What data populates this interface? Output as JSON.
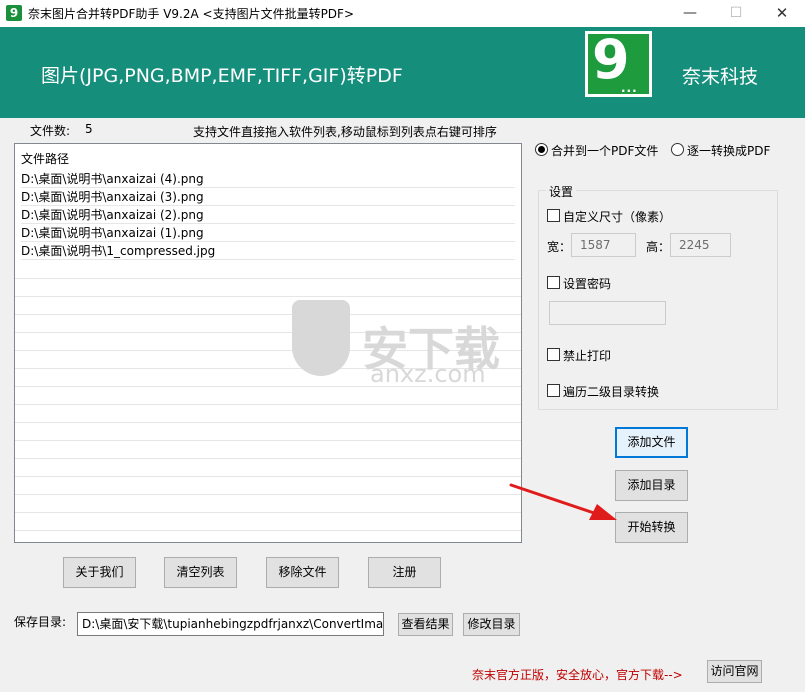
{
  "window": {
    "title": "奈末图片合并转PDF助手 V9.2A  <支持图片文件批量转PDF>",
    "icon_glyph": "9",
    "controls": {
      "minimize": "—",
      "maximize": "☐",
      "close": "✕"
    }
  },
  "banner": {
    "title": "图片(JPG,PNG,BMP,EMF,TIFF,GIF)转PDF",
    "logo_digit": "9",
    "logo_dots": "...",
    "company": "奈末科技",
    "color": "#168e7c"
  },
  "file_count": {
    "label": "文件数:",
    "value": "5"
  },
  "hint": "支持文件直接拖入软件列表,移动鼠标到列表点右键可排序",
  "file_list": {
    "header": "文件路径",
    "rows": [
      "D:\\桌面\\说明书\\anxaizai (4).png",
      "D:\\桌面\\说明书\\anxaizai (3).png",
      "D:\\桌面\\说明书\\anxaizai (2).png",
      "D:\\桌面\\说明书\\anxaizai (1).png",
      "D:\\桌面\\说明书\\1_compressed.jpg"
    ]
  },
  "watermark": {
    "text": "安下载",
    "sub": "anxz.com"
  },
  "mode": {
    "merge_label": "合并到一个PDF文件",
    "each_label": "逐一转换成PDF",
    "selected": "merge"
  },
  "settings": {
    "legend": "设置",
    "custom_size_label": "自定义尺寸（像素）",
    "width_label": "宽：",
    "width_value": "1587",
    "height_label": "高：",
    "height_value": "2245",
    "password_label": "设置密码",
    "password_value": "",
    "no_print_label": "禁止打印",
    "subdir_label": "遍历二级目录转换"
  },
  "actions": {
    "add_file": "添加文件",
    "add_dir": "添加目录",
    "start": "开始转换",
    "about": "关于我们",
    "clear": "清空列表",
    "remove": "移除文件",
    "register": "注册"
  },
  "save": {
    "label": "保存目录:",
    "path": "D:\\桌面\\安下载\\tupianhebingzpdfrjanxz\\ConvertImageT",
    "view": "查看结果",
    "change": "修改目录"
  },
  "footer": {
    "note": "奈末官方正版，安全放心，官方下载-->",
    "visit": "访问官网",
    "note_color": "#c00000"
  }
}
